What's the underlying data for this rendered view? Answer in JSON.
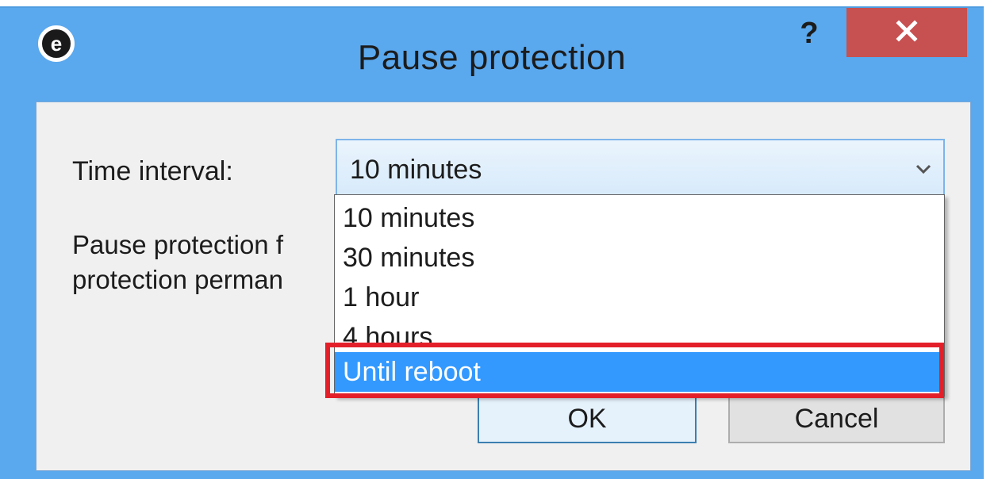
{
  "window": {
    "title": "Pause protection",
    "help_glyph": "?",
    "app_icon": "eset-logo-icon",
    "close_icon": "close-icon"
  },
  "form": {
    "interval_label": "Time interval:",
    "selected_value": "10 minutes",
    "description_line1": "Pause protection f",
    "description_line2": "protection perman"
  },
  "dropdown": {
    "options": [
      "10 minutes",
      "30 minutes",
      "1 hour",
      "4 hours",
      "Until reboot"
    ],
    "highlighted_index": 4
  },
  "buttons": {
    "ok_label": "OK",
    "cancel_label": "Cancel"
  },
  "colors": {
    "titlebar": "#5aa8ee",
    "close_button": "#c75050",
    "selection": "#3399ff",
    "annotation_border": "#e3202a"
  }
}
